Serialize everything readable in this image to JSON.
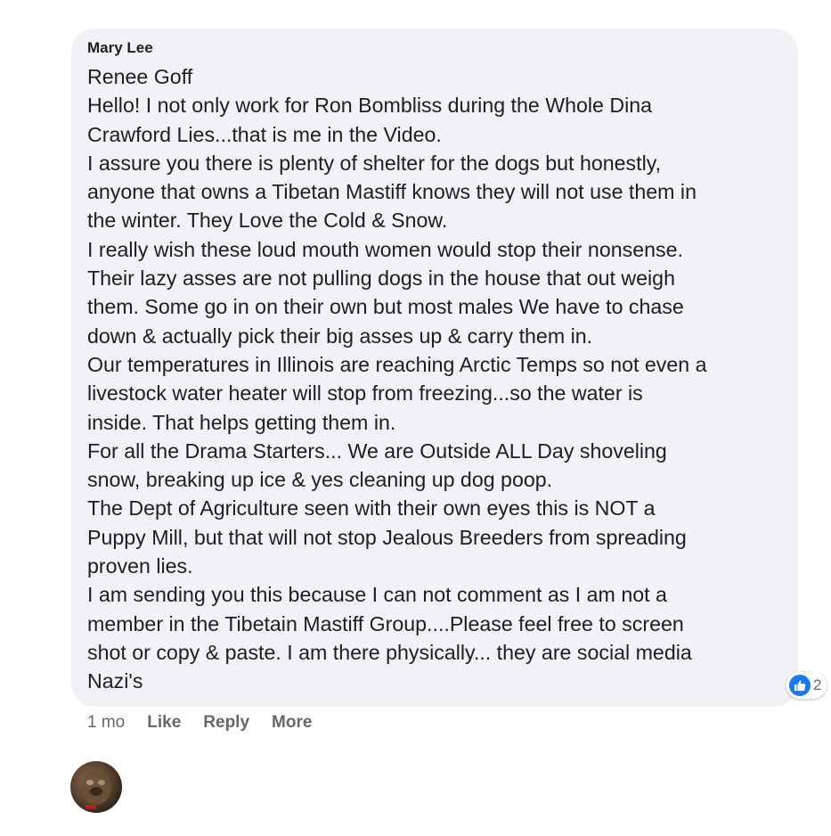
{
  "comment": {
    "author": "Mary Lee",
    "lines": [
      "Renee Goff",
      "Hello! I not only work for Ron Bombliss during the Whole Dina",
      "Crawford Lies...that is me in the Video.",
      "I assure you there is plenty of shelter for the dogs but honestly,",
      "anyone that owns a Tibetan Mastiff knows they will not use them in",
      "the winter. They Love the Cold & Snow.",
      "I really wish these loud mouth women would stop their nonsense.",
      "Their lazy asses are not pulling dogs in the house that out weigh",
      "them. Some go in on their own but most males We have to chase",
      "down & actually pick their big asses up & carry them in.",
      "Our temperatures in Illinois are reaching Arctic Temps so not even a",
      "livestock water heater will stop from freezing...so the water is",
      "inside. That helps getting them in.",
      "For all the Drama Starters... We are Outside ALL Day shoveling",
      "snow, breaking up ice & yes cleaning up dog poop.",
      "The Dept of Agriculture seen with their own eyes this is NOT a",
      "Puppy Mill, but that will not stop Jealous Breeders from spreading",
      "proven lies.",
      "I am sending you this because I can not comment as I am not a",
      "member in the Tibetain Mastiff Group....Please feel free to screen",
      "shot or copy & paste. I am there physically... they are social media",
      "Nazi's"
    ],
    "reaction_count": "2",
    "reaction_icon": "like-icon",
    "timestamp": "1 mo",
    "actions": {
      "like": "Like",
      "reply": "Reply",
      "more": "More"
    }
  },
  "colors": {
    "bubble_background": "#f0f2f5",
    "text": "#1c1e21",
    "secondary_text": "#65676b",
    "like_blue": "#1877f2"
  }
}
